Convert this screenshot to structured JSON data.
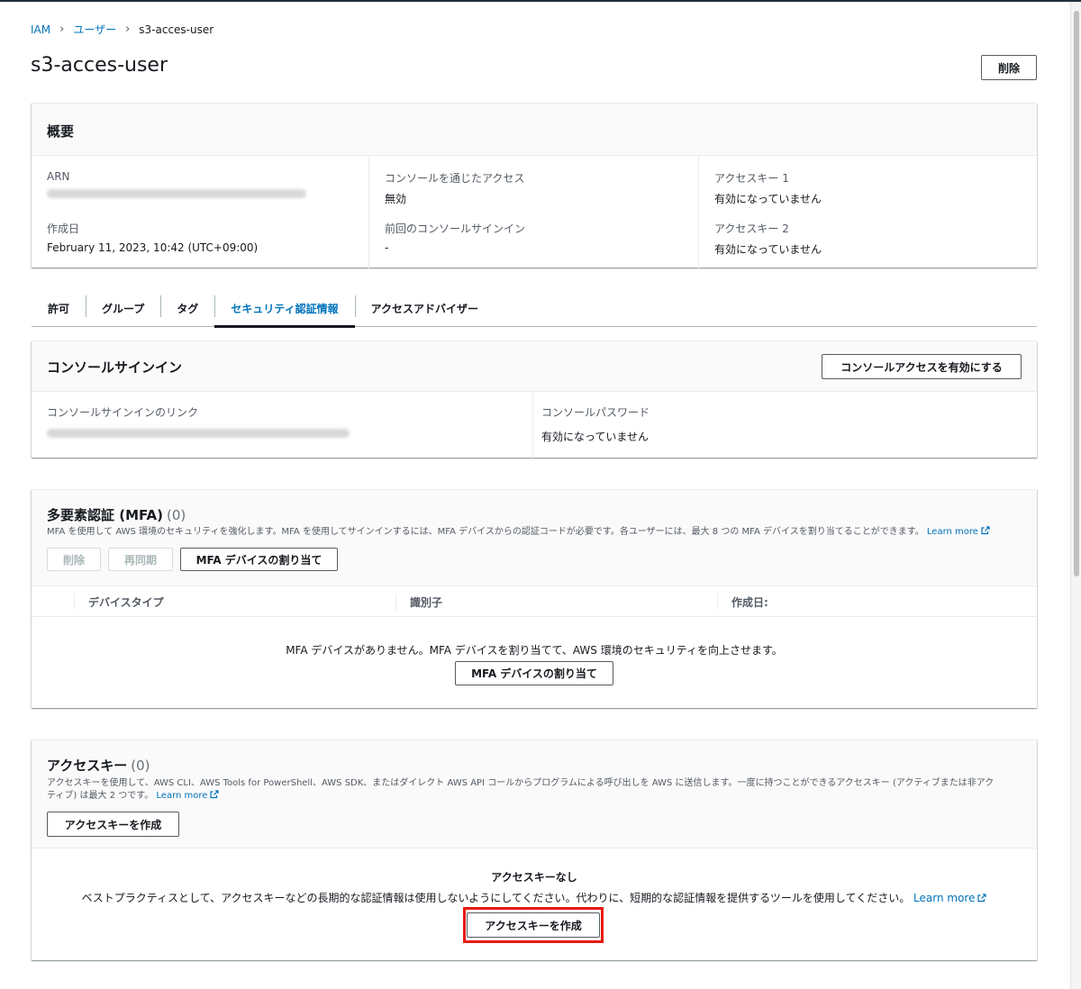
{
  "breadcrumb": {
    "root": "IAM",
    "users": "ユーザー",
    "current": "s3-acces-user"
  },
  "page": {
    "title": "s3-acces-user",
    "delete_label": "削除"
  },
  "summary": {
    "title": "概要",
    "arn_label": "ARN",
    "created_label": "作成日",
    "created_value": "February 11, 2023, 10:42 (UTC+09:00)",
    "console_access_label": "コンソールを通じたアクセス",
    "console_access_value": "無効",
    "last_signin_label": "前回のコンソールサインイン",
    "last_signin_value": "-",
    "key1_label": "アクセスキー 1",
    "key1_value": "有効になっていません",
    "key2_label": "アクセスキー 2",
    "key2_value": "有効になっていません"
  },
  "tabs": [
    "許可",
    "グループ",
    "タグ",
    "セキュリティ認証情報",
    "アクセスアドバイザー"
  ],
  "console": {
    "title": "コンソールサインイン",
    "enable_label": "コンソールアクセスを有効にする",
    "link_label": "コンソールサインインのリンク",
    "password_label": "コンソールパスワード",
    "password_value": "有効になっていません"
  },
  "mfa": {
    "title": "多要素認証 (MFA)",
    "count": "(0)",
    "description": "MFA を使用して AWS 環境のセキュリティを強化します。MFA を使用してサインインするには、MFA デバイスからの認証コードが必要です。各ユーザーには、最大 8 つの MFA デバイスを割り当てることができます。",
    "learn_more": "Learn more",
    "delete_label": "削除",
    "resync_label": "再同期",
    "assign_label": "MFA デバイスの割り当て",
    "columns": [
      "デバイスタイプ",
      "識別子",
      "作成日:"
    ],
    "empty_text": "MFA デバイスがありません。MFA デバイスを割り当てて、AWS 環境のセキュリティを向上させます。",
    "empty_assign_label": "MFA デバイスの割り当て"
  },
  "access_keys": {
    "title": "アクセスキー",
    "count": "(0)",
    "description_line1": "アクセスキーを使用して、AWS CLI、AWS Tools for PowerShell、AWS SDK、またはダイレクト AWS API コールからプログラムによる呼び出しを AWS に送信します。一度に持つことができるアクセスキー (アクティブまたは非アク",
    "description_line2": "ティブ) は最大 2 つです。",
    "learn_more": "Learn more",
    "create_label": "アクセスキーを作成",
    "empty_title": "アクセスキーなし",
    "empty_text": "ベストプラクティスとして、アクセスキーなどの長期的な認証情報は使用しないようにしてください。代わりに、短期的な認証情報を提供するツールを使用してください。",
    "empty_learn_more": "Learn more",
    "empty_create_label": "アクセスキーを作成"
  },
  "colors": {
    "link": "#0073bb",
    "highlight": "#e8190e",
    "text": "#16191f"
  }
}
